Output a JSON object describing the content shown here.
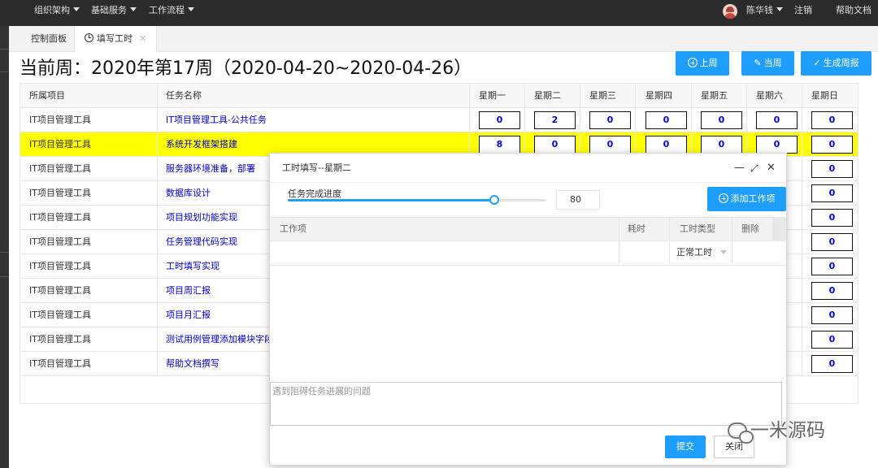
{
  "topnav": {
    "menus": [
      "组织架构",
      "基础服务",
      "工作流程"
    ],
    "user": "陈华钱",
    "logout": "注销",
    "help": "帮助文档"
  },
  "tabs": [
    {
      "label": "控制面板",
      "active": false
    },
    {
      "label": "填写工时",
      "active": true
    }
  ],
  "title": "当前周：2020年第17周（2020-04-20~2020-04-26）",
  "buttons": {
    "prev_week": "上周",
    "current_week": "当周",
    "generate_report": "生成周报"
  },
  "table": {
    "headers": [
      "所属项目",
      "任务名称",
      "星期一",
      "星期二",
      "星期三",
      "星期四",
      "星期五",
      "星期六",
      "星期日"
    ],
    "rows": [
      {
        "project": "IT项目管理工具",
        "task": "IT项目管理工具-公共任务",
        "hours": [
          "0",
          "2",
          "0",
          "0",
          "0",
          "0",
          "0"
        ],
        "highlight": false
      },
      {
        "project": "IT项目管理工具",
        "task": "系统开发框架搭建",
        "hours": [
          "8",
          "0",
          "0",
          "0",
          "0",
          "0",
          "0"
        ],
        "highlight": true
      },
      {
        "project": "IT项目管理工具",
        "task": "服务器环境准备，部署",
        "hours": [
          "",
          "",
          "",
          "",
          "",
          "",
          "0"
        ],
        "highlight": false
      },
      {
        "project": "IT项目管理工具",
        "task": "数据库设计",
        "hours": [
          "",
          "",
          "",
          "",
          "",
          "",
          "0"
        ],
        "highlight": false
      },
      {
        "project": "IT项目管理工具",
        "task": "项目规划功能实现",
        "hours": [
          "",
          "",
          "",
          "",
          "",
          "",
          "0"
        ],
        "highlight": false
      },
      {
        "project": "IT项目管理工具",
        "task": "任务管理代码实现",
        "hours": [
          "",
          "",
          "",
          "",
          "",
          "",
          "0"
        ],
        "highlight": false
      },
      {
        "project": "IT项目管理工具",
        "task": "工时填写实现",
        "hours": [
          "",
          "",
          "",
          "",
          "",
          "",
          "0"
        ],
        "highlight": false
      },
      {
        "project": "IT项目管理工具",
        "task": "项目周汇报",
        "hours": [
          "",
          "",
          "",
          "",
          "",
          "",
          "0"
        ],
        "highlight": false
      },
      {
        "project": "IT项目管理工具",
        "task": "项目月汇报",
        "hours": [
          "",
          "",
          "",
          "",
          "",
          "",
          "0"
        ],
        "highlight": false
      },
      {
        "project": "IT项目管理工具",
        "task": "测试用例管理添加模块字段",
        "hours": [
          "",
          "",
          "",
          "",
          "",
          "",
          "0"
        ],
        "highlight": false
      },
      {
        "project": "IT项目管理工具",
        "task": "帮助文档撰写",
        "hours": [
          "",
          "",
          "",
          "",
          "",
          "",
          "0"
        ],
        "highlight": false
      }
    ]
  },
  "dialog": {
    "title": "工时填写--星期二",
    "progress_label": "任务完成进度",
    "progress_value": "80",
    "progress_fraction": 0.8,
    "add_item": "添加工作项",
    "columns": [
      "工作项",
      "耗时",
      "工时类型",
      "删除"
    ],
    "row": {
      "item": "",
      "hours": "",
      "type": "正常工时"
    },
    "problem_placeholder": "遇到阻碍任务进展的问题",
    "submit": "提交",
    "close": "关闭"
  },
  "watermark": "一米源码",
  "colors": {
    "primary": "#1e9fff",
    "highlight": "#ffff00",
    "topbar": "#2b2b2b"
  }
}
